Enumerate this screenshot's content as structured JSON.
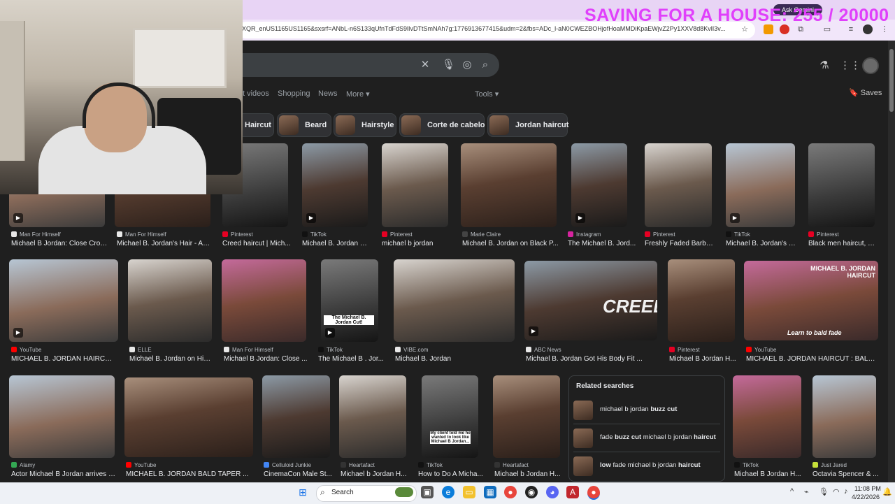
{
  "browser": {
    "url": "XQR_enUS1165US1165&sxsrf=ANbL-n6S133qUfnTdFdS9lIvDTtSmNAh7g:1776913677415&udm=2&fbs=ADc_l-aN0CWEZBOHjofHoaMMDiKpaEWjvZ2Py1XXV8d8KvlI3v...",
    "gemini_label": "Ask Gemini",
    "overlay_text": "SAVING FOR A HOUSE: 255 / 20000"
  },
  "search": {
    "clear_icon": "close-icon",
    "voice_icon": "microphone-icon",
    "lens_icon": "lens-icon",
    "search_icon": "search-icon"
  },
  "nav": {
    "tabs": [
      "t videos",
      "Shopping",
      "News",
      "More"
    ],
    "tools": "Tools",
    "saves": "Saves"
  },
  "chips": [
    "Haircut",
    "Beard",
    "Hairstyle",
    "Corte de cabelo",
    "Jordan haircut"
  ],
  "rows": [
    [
      {
        "source": "Man For Himself",
        "title": "Michael B Jordan: Close Crop...",
        "icon_color": "#e8e8e8"
      },
      {
        "source": "Man For Himself",
        "title": "Michael B. Jordan's Hair - Afr...",
        "icon_color": "#e8e8e8"
      },
      {
        "source": "Pinterest",
        "title": "Creed haircut | Mich...",
        "icon_color": "#e60023"
      },
      {
        "source": "TikTok",
        "title": "Michael B. Jordan W...",
        "icon_color": "#111111"
      },
      {
        "source": "Pinterest",
        "title": "michael b jordan",
        "icon_color": "#e60023"
      },
      {
        "source": "Marie Claire",
        "title": "Michael B. Jordan on Black P...",
        "icon_color": "#444444"
      },
      {
        "source": "Instagram",
        "title": "The Michael B. Jord...",
        "icon_color": "#d6249f"
      },
      {
        "source": "Pinterest",
        "title": "Freshly Faded Barber...",
        "icon_color": "#e60023"
      },
      {
        "source": "TikTok",
        "title": "Michael B. Jordan's F...",
        "icon_color": "#111111"
      },
      {
        "source": "Pinterest",
        "title": "Black men haircut, H...",
        "icon_color": "#e60023"
      }
    ],
    [
      {
        "source": "YouTube",
        "title": "MICHAEL B. JORDAN HAIRCUT | ...",
        "icon_color": "#ff0000"
      },
      {
        "source": "ELLE",
        "title": "Michael B. Jordan on His ...",
        "icon_color": "#e8e8e8"
      },
      {
        "source": "Man For Himself",
        "title": "Michael B Jordan: Close ...",
        "icon_color": "#e8e8e8"
      },
      {
        "source": "TikTok",
        "title": "The Michael B . Jor...",
        "icon_color": "#111111"
      },
      {
        "source": "VIBE.com",
        "title": "Michael B. Jordan",
        "icon_color": "#e8e8e8"
      },
      {
        "source": "ABC News",
        "title": "Michael B. Jordan Got His Body Fit ...",
        "icon_color": "#e8e8e8"
      },
      {
        "source": "Pinterest",
        "title": "Michael B Jordan H...",
        "icon_color": "#e60023"
      },
      {
        "source": "YouTube",
        "title": "MICHAEL B. JORDAN HAIRCUT : BALD FA...",
        "icon_color": "#ff0000"
      }
    ],
    [
      {
        "source": "Alamy",
        "title": "Actor Michael B Jordan arrives o...",
        "icon_color": "#34a853"
      },
      {
        "source": "YouTube",
        "title": "MICHAEL B. JORDAN BALD TAPER ...",
        "icon_color": "#ff0000"
      },
      {
        "source": "Celluloid Junkie",
        "title": "CinemaCon Male St...",
        "icon_color": "#4285f4"
      },
      {
        "source": "Heartafact",
        "title": "Michael b Jordan H...",
        "icon_color": "#333333"
      },
      {
        "source": "TikTok",
        "title": "How to Do A Micha...",
        "icon_color": "#111111"
      },
      {
        "source": "Heartafact",
        "title": "Michael b Jordan H...",
        "icon_color": "#333333"
      },
      {
        "source": "TikTok",
        "title": "Michael B Jordan H...",
        "icon_color": "#111111"
      },
      {
        "source": "Just Jared",
        "title": "Octavia Spencer & ...",
        "icon_color": "#c6e03a"
      }
    ]
  ],
  "image_overlays": {
    "creed": "CREED",
    "mbj_haircut": "MICHAEL B. JORDAN HAIRCUT",
    "bald_fade": "Learn to bald fade",
    "tiktok_caption": "The Michael B. Jordan Cut!",
    "client_caption": "My client told me he wanted to look like Michael B Jordan..."
  },
  "related": {
    "title": "Related searches",
    "items": [
      {
        "pre": "michael b jordan ",
        "bold": "buzz cut",
        "post": "",
        "bold2": ""
      },
      {
        "pre": "fade ",
        "bold": "buzz cut",
        "post": " michael b jordan ",
        "bold2": "haircut"
      },
      {
        "pre": "",
        "bold": "low",
        "post": " fade michael b jordan ",
        "bold2": "haircut"
      }
    ]
  },
  "taskbar": {
    "search_label": "Search",
    "time": "11:08 PM",
    "date": "4/22/2026"
  }
}
